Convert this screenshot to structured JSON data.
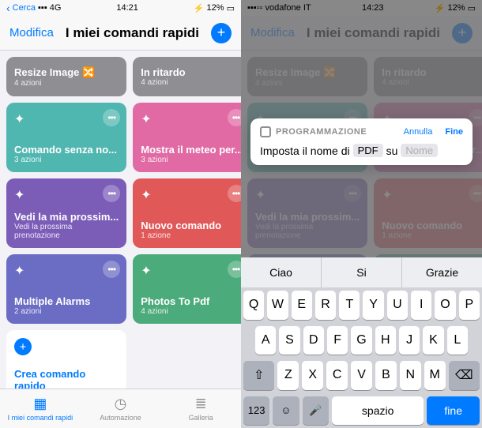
{
  "left": {
    "status": {
      "search": "Cerca",
      "net": "4G",
      "time": "14:21",
      "batt": "12%"
    },
    "nav": {
      "edit": "Modifica",
      "title": "I miei comandi rapidi"
    },
    "cards": [
      {
        "title": "Resize Image 🔀",
        "sub": "4 azioni",
        "cls": "c-grey",
        "short": true
      },
      {
        "title": "In ritardo",
        "sub": "4 azioni",
        "cls": "c-grey",
        "short": true
      },
      {
        "title": "Comando senza no...",
        "sub": "3 azioni",
        "cls": "c-teal",
        "short": false
      },
      {
        "title": "Mostra il meteo per...",
        "sub": "3 azioni",
        "cls": "c-pink",
        "short": false
      },
      {
        "title": "Vedi la mia prossim...",
        "sub": "Vedi la prossima prenotazione",
        "cls": "c-purple",
        "short": false
      },
      {
        "title": "Nuovo comando",
        "sub": "1 azione",
        "cls": "c-red",
        "short": false
      },
      {
        "title": "Multiple Alarms",
        "sub": "2 azioni",
        "cls": "c-indigo",
        "short": false
      },
      {
        "title": "Photos To Pdf",
        "sub": "4 azioni",
        "cls": "c-green",
        "short": false
      }
    ],
    "create": "Crea comando rapido",
    "tabs": {
      "shortcuts": "I miei comandi rapidi",
      "automation": "Automazione",
      "gallery": "Galleria"
    }
  },
  "right": {
    "status": {
      "carrier": "vodafone IT",
      "time": "14:23",
      "batt": "12%"
    },
    "nav": {
      "edit": "Modifica",
      "title": "I miei comandi rapidi"
    },
    "popup": {
      "category": "PROGRAMMAZIONE",
      "cancel": "Annulla",
      "done": "Fine",
      "text1": "Imposta il nome di",
      "token1": "PDF",
      "text2": "su",
      "token2": "Nome"
    },
    "suggest": [
      "Ciao",
      "Si",
      "Grazie"
    ],
    "keys": {
      "r1": [
        "Q",
        "W",
        "E",
        "R",
        "T",
        "Y",
        "U",
        "I",
        "O",
        "P"
      ],
      "r2": [
        "A",
        "S",
        "D",
        "F",
        "G",
        "H",
        "J",
        "K",
        "L"
      ],
      "r3": [
        "Z",
        "X",
        "C",
        "V",
        "B",
        "N",
        "M"
      ],
      "num": "123",
      "space": "spazio",
      "return": "fine"
    }
  }
}
